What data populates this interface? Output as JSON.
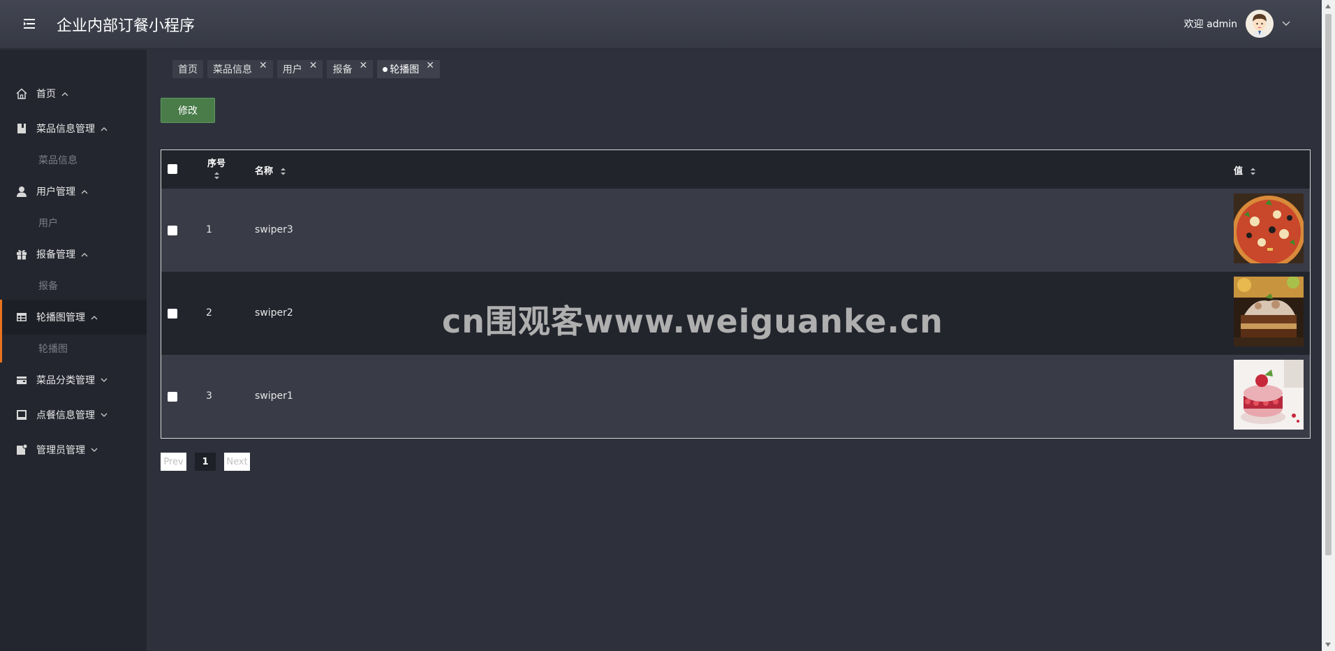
{
  "header": {
    "title": "企业内部订餐小程序",
    "welcome": "欢迎 admin"
  },
  "sidebar": {
    "items": [
      {
        "label": "首页",
        "icon": "home-icon",
        "expanded": true
      },
      {
        "label": "菜品信息管理",
        "icon": "book-icon",
        "expanded": true,
        "sub": "菜品信息"
      },
      {
        "label": "用户管理",
        "icon": "user-icon",
        "expanded": true,
        "sub": "用户"
      },
      {
        "label": "报备管理",
        "icon": "gift-icon",
        "expanded": true,
        "sub": "报备"
      },
      {
        "label": "轮播图管理",
        "icon": "table-icon",
        "expanded": true,
        "sub": "轮播图",
        "active": true
      },
      {
        "label": "菜品分类管理",
        "icon": "wallet-icon",
        "expanded": false
      },
      {
        "label": "点餐信息管理",
        "icon": "inbox-icon",
        "expanded": false
      },
      {
        "label": "管理员管理",
        "icon": "admin-icon",
        "expanded": false
      }
    ]
  },
  "tabs": [
    {
      "label": "首页",
      "closable": false
    },
    {
      "label": "菜品信息",
      "closable": true
    },
    {
      "label": "用户",
      "closable": true
    },
    {
      "label": "报备",
      "closable": true
    },
    {
      "label": "轮播图",
      "closable": true,
      "active": true
    }
  ],
  "toolbar": {
    "edit_label": "修改"
  },
  "table": {
    "columns": [
      "序号",
      "名称",
      "值"
    ],
    "rows": [
      {
        "index": "1",
        "name": "swiper3",
        "image": "pizza"
      },
      {
        "index": "2",
        "name": "swiper2",
        "image": "cake-slice"
      },
      {
        "index": "3",
        "name": "swiper1",
        "image": "macaron"
      }
    ]
  },
  "pagination": {
    "prev": "Prev",
    "current": "1",
    "next": "Next"
  },
  "watermark": "cn围观客www.weiguanke.cn",
  "colors": {
    "accent": "#e8731e",
    "button_green": "#4a7c4a",
    "header_bg": "#3d404b",
    "sidebar_bg": "#24262f"
  }
}
